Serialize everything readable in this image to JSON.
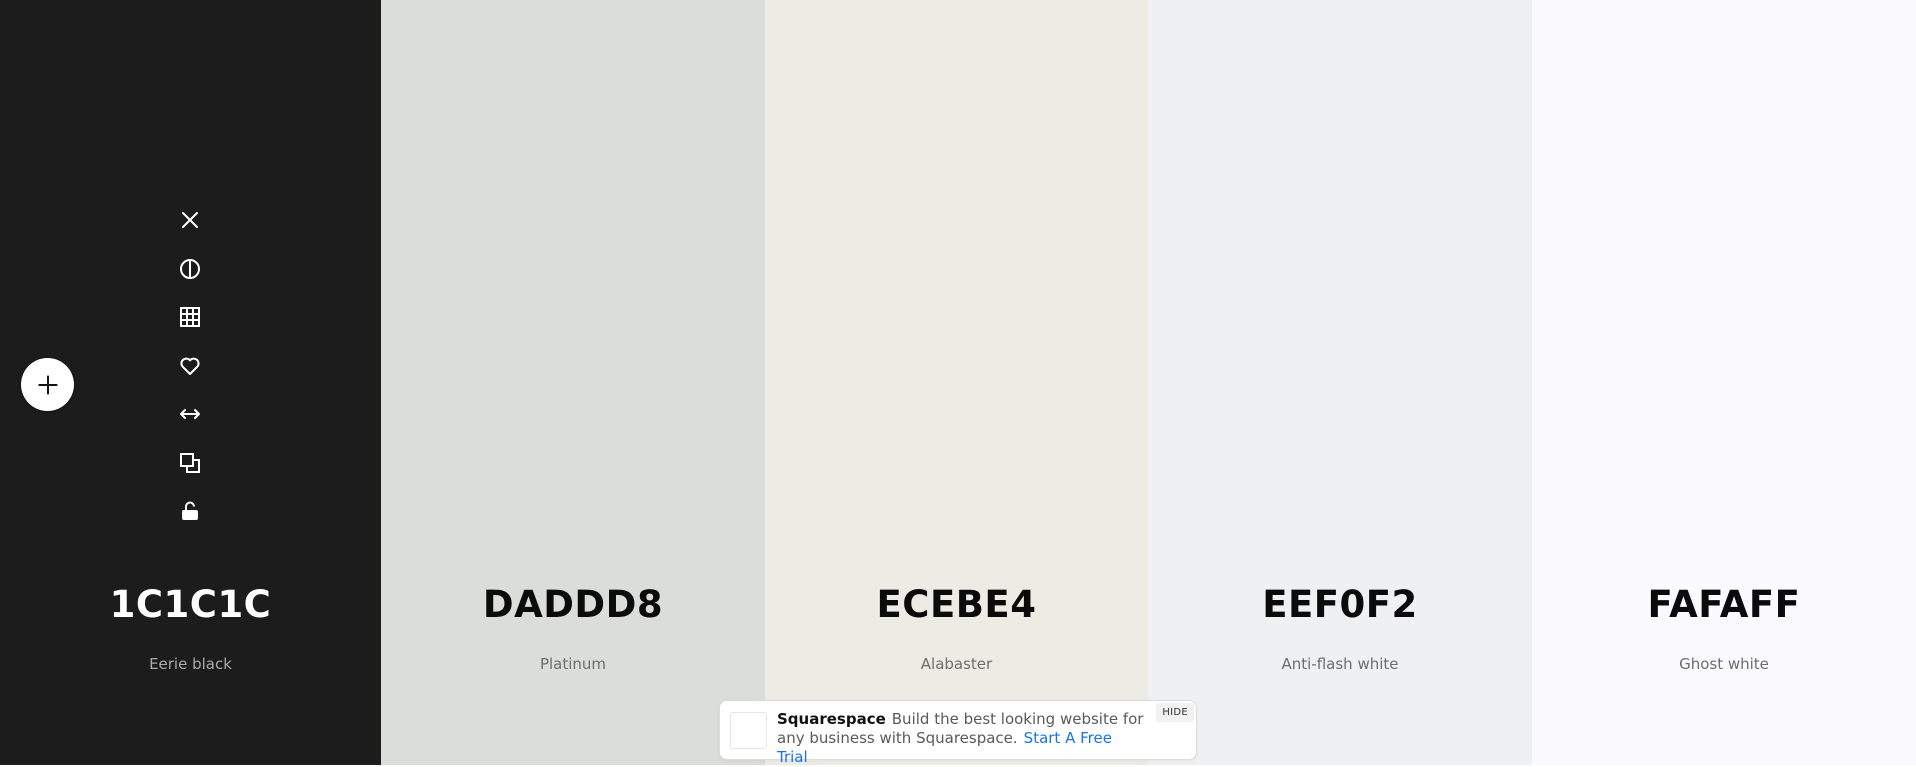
{
  "palette": {
    "swatches": [
      {
        "hex": "1C1C1C",
        "name": "Eerie black",
        "color": "#1c1c1c"
      },
      {
        "hex": "DADDD8",
        "name": "Platinum",
        "color": "#daddd8"
      },
      {
        "hex": "ECEBE4",
        "name": "Alabaster",
        "color": "#ecebe4"
      },
      {
        "hex": "EEF0F2",
        "name": "Anti-flash white",
        "color": "#eef0f2"
      },
      {
        "hex": "FAFAFF",
        "name": "Ghost white",
        "color": "#fafaff"
      }
    ]
  },
  "toolbar": {
    "icons": [
      "close-icon",
      "contrast-icon",
      "shades-grid-icon",
      "heart-icon",
      "drag-arrows-icon",
      "copy-icon",
      "unlock-icon"
    ]
  },
  "add_button": {
    "icon": "plus-icon"
  },
  "ad": {
    "brand": "Squarespace",
    "text": "Build the best looking website for any business with Squarespace.",
    "cta": "Start A Free Trial",
    "hide_label": "HIDE",
    "cta_color": "#1a73e8"
  }
}
